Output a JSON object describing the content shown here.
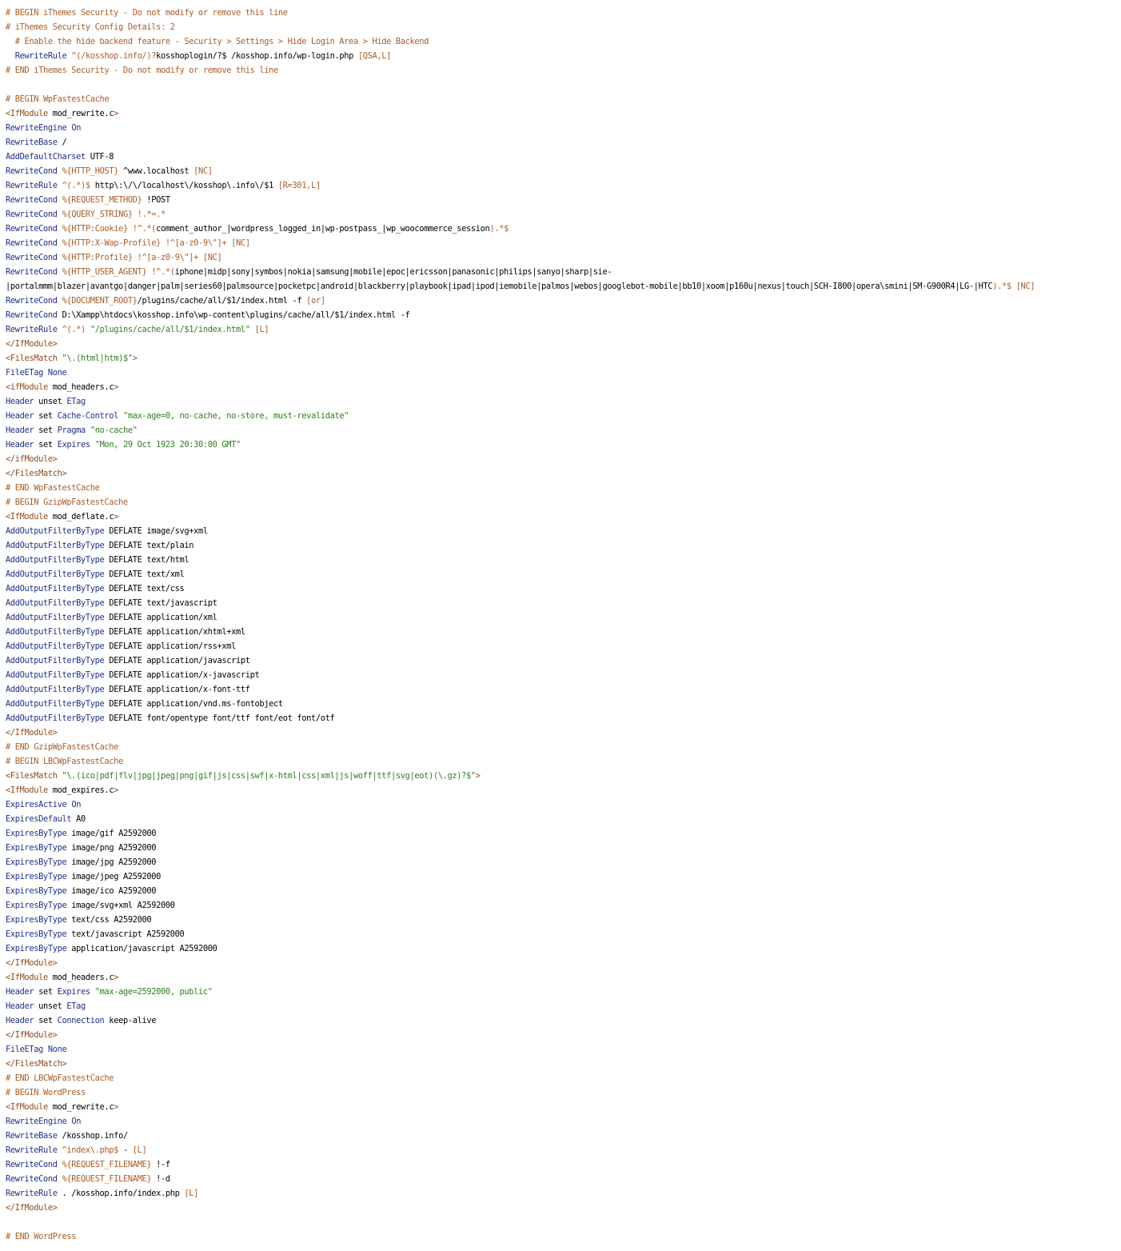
{
  "colors": {
    "comment": "#a85c28",
    "directive": "#1f2f8a",
    "tag": "#8f4a1a",
    "string": "#2e7d1f",
    "variable": "#a85c28",
    "plain": "#000000",
    "background": "#ffffff"
  },
  "lines": [
    [
      [
        "cm",
        "# BEGIN iThemes Security - Do not modify or remove this line"
      ]
    ],
    [
      [
        "cm",
        "# iThemes Security Config Details: 2"
      ]
    ],
    [
      [
        "cm",
        "  # Enable the hide backend feature - Security > Settings > Hide Login Area > Hide Backend"
      ]
    ],
    [
      [
        "pl",
        "  "
      ],
      [
        "kw",
        "RewriteRule"
      ],
      [
        "pl",
        " "
      ],
      [
        "vr",
        "^(/kosshop.info/)?"
      ],
      [
        "pl",
        "kosshoplogin/?$ /kosshop.info/wp-login.php "
      ],
      [
        "vr",
        "[QSA,L]"
      ]
    ],
    [
      [
        "cm",
        "# END iThemes Security - Do not modify or remove this line"
      ]
    ],
    [
      [
        "pl",
        ""
      ]
    ],
    [
      [
        "cm",
        "# BEGIN WpFastestCache"
      ]
    ],
    [
      [
        "tg",
        "<IfModule"
      ],
      [
        "pl",
        " mod_rewrite.c"
      ],
      [
        "tg",
        ">"
      ]
    ],
    [
      [
        "kw",
        "RewriteEngine"
      ],
      [
        "pl",
        " "
      ],
      [
        "kw",
        "On"
      ]
    ],
    [
      [
        "kw",
        "RewriteBase"
      ],
      [
        "pl",
        " /"
      ]
    ],
    [
      [
        "kw",
        "AddDefaultCharset"
      ],
      [
        "pl",
        " UTF-8"
      ]
    ],
    [
      [
        "kw",
        "RewriteCond"
      ],
      [
        "pl",
        " "
      ],
      [
        "vr",
        "%{HTTP_HOST}"
      ],
      [
        "pl",
        " ^www.localhost "
      ],
      [
        "vr",
        "[NC]"
      ]
    ],
    [
      [
        "kw",
        "RewriteRule"
      ],
      [
        "pl",
        " "
      ],
      [
        "vr",
        "^(.*)$"
      ],
      [
        "pl",
        " http\\:\\/\\/localhost\\/kosshop\\.info\\/$1 "
      ],
      [
        "vr",
        "[R=301,L]"
      ]
    ],
    [
      [
        "kw",
        "RewriteCond"
      ],
      [
        "pl",
        " "
      ],
      [
        "vr",
        "%{REQUEST_METHOD}"
      ],
      [
        "pl",
        " !POST"
      ]
    ],
    [
      [
        "kw",
        "RewriteCond"
      ],
      [
        "pl",
        " "
      ],
      [
        "vr",
        "%{QUERY_STRING}"
      ],
      [
        "pl",
        " "
      ],
      [
        "vr",
        "!.*=.*"
      ]
    ],
    [
      [
        "kw",
        "RewriteCond"
      ],
      [
        "pl",
        " "
      ],
      [
        "vr",
        "%{HTTP:Cookie}"
      ],
      [
        "pl",
        " "
      ],
      [
        "vr",
        "!^.*("
      ],
      [
        "pl",
        "comment_author_|wordpress_logged_in|wp-postpass_|wp_woocommerce_session"
      ],
      [
        "vr",
        ").*$"
      ]
    ],
    [
      [
        "kw",
        "RewriteCond"
      ],
      [
        "pl",
        " "
      ],
      [
        "vr",
        "%{HTTP:X-Wap-Profile}"
      ],
      [
        "pl",
        " "
      ],
      [
        "vr",
        "!^[a-z0-9\\\"]+"
      ],
      [
        "pl",
        " "
      ],
      [
        "vr",
        "[NC]"
      ]
    ],
    [
      [
        "kw",
        "RewriteCond"
      ],
      [
        "pl",
        " "
      ],
      [
        "vr",
        "%{HTTP:Profile}"
      ],
      [
        "pl",
        " "
      ],
      [
        "vr",
        "!^[a-z0-9\\\"]+"
      ],
      [
        "pl",
        " "
      ],
      [
        "vr",
        "[NC]"
      ]
    ],
    [
      [
        "kw",
        "RewriteCond"
      ],
      [
        "pl",
        " "
      ],
      [
        "vr",
        "%{HTTP_USER_AGENT}"
      ],
      [
        "pl",
        " "
      ],
      [
        "vr",
        "!^.*("
      ],
      [
        "pl",
        "iphone|midp|sony|symbos|nokia|samsung|mobile|epoc|ericsson|panasonic|philips|sanyo|sharp|sie-"
      ]
    ],
    [
      [
        "pl",
        "|portalmmm|blazer|avantgo|danger|palm|series60|palmsource|pocketpc|android|blackberry|playbook|ipad|ipod|iemobile|palmos|webos|googlebot-mobile|bb10|xoom|p160u|nexus|touch|SCH-I800|opera\\smini|SM-G900R4|LG-|HTC"
      ],
      [
        "vr",
        ").*$"
      ],
      [
        "pl",
        " "
      ],
      [
        "vr",
        "[NC]"
      ]
    ],
    [
      [
        "kw",
        "RewriteCond"
      ],
      [
        "pl",
        " "
      ],
      [
        "vr",
        "%{DOCUMENT_ROOT}"
      ],
      [
        "pl",
        "/plugins/cache/all/$1/index.html -f "
      ],
      [
        "vr",
        "[or]"
      ]
    ],
    [
      [
        "kw",
        "RewriteCond"
      ],
      [
        "pl",
        " D:\\Xampp\\htdocs\\kosshop.info\\wp-content\\plugins/cache/all/$1/index.html -f"
      ]
    ],
    [
      [
        "kw",
        "RewriteRule"
      ],
      [
        "pl",
        " "
      ],
      [
        "vr",
        "^(.*)"
      ],
      [
        "pl",
        " "
      ],
      [
        "st",
        "\"/plugins/cache/all/$1/index.html\""
      ],
      [
        "pl",
        " "
      ],
      [
        "vr",
        "[L]"
      ]
    ],
    [
      [
        "tg",
        "</IfModule>"
      ]
    ],
    [
      [
        "tg",
        "<FilesMatch"
      ],
      [
        "pl",
        " "
      ],
      [
        "st",
        "\"\\.(html|htm)$\""
      ],
      [
        "tg",
        ">"
      ]
    ],
    [
      [
        "kw",
        "FileETag"
      ],
      [
        "pl",
        " "
      ],
      [
        "kw",
        "None"
      ]
    ],
    [
      [
        "tg",
        "<ifModule"
      ],
      [
        "pl",
        " mod_headers.c"
      ],
      [
        "tg",
        ">"
      ]
    ],
    [
      [
        "kw",
        "Header"
      ],
      [
        "pl",
        " unset "
      ],
      [
        "kw",
        "ETag"
      ]
    ],
    [
      [
        "kw",
        "Header"
      ],
      [
        "pl",
        " set "
      ],
      [
        "kw",
        "Cache-Control"
      ],
      [
        "pl",
        " "
      ],
      [
        "st",
        "\"max-age=0, no-cache, no-store, must-revalidate\""
      ]
    ],
    [
      [
        "kw",
        "Header"
      ],
      [
        "pl",
        " set "
      ],
      [
        "kw",
        "Pragma"
      ],
      [
        "pl",
        " "
      ],
      [
        "st",
        "\"no-cache\""
      ]
    ],
    [
      [
        "kw",
        "Header"
      ],
      [
        "pl",
        " set "
      ],
      [
        "kw",
        "Expires"
      ],
      [
        "pl",
        " "
      ],
      [
        "st",
        "\"Mon, 29 Oct 1923 20:30:00 GMT\""
      ]
    ],
    [
      [
        "tg",
        "</ifModule>"
      ]
    ],
    [
      [
        "tg",
        "</FilesMatch>"
      ]
    ],
    [
      [
        "cm",
        "# END WpFastestCache"
      ]
    ],
    [
      [
        "cm",
        "# BEGIN GzipWpFastestCache"
      ]
    ],
    [
      [
        "tg",
        "<IfModule"
      ],
      [
        "pl",
        " mod_deflate.c"
      ],
      [
        "tg",
        ">"
      ]
    ],
    [
      [
        "kw",
        "AddOutputFilterByType"
      ],
      [
        "pl",
        " DEFLATE image/svg+xml"
      ]
    ],
    [
      [
        "kw",
        "AddOutputFilterByType"
      ],
      [
        "pl",
        " DEFLATE text/plain"
      ]
    ],
    [
      [
        "kw",
        "AddOutputFilterByType"
      ],
      [
        "pl",
        " DEFLATE text/html"
      ]
    ],
    [
      [
        "kw",
        "AddOutputFilterByType"
      ],
      [
        "pl",
        " DEFLATE text/xml"
      ]
    ],
    [
      [
        "kw",
        "AddOutputFilterByType"
      ],
      [
        "pl",
        " DEFLATE text/css"
      ]
    ],
    [
      [
        "kw",
        "AddOutputFilterByType"
      ],
      [
        "pl",
        " DEFLATE text/javascript"
      ]
    ],
    [
      [
        "kw",
        "AddOutputFilterByType"
      ],
      [
        "pl",
        " DEFLATE application/xml"
      ]
    ],
    [
      [
        "kw",
        "AddOutputFilterByType"
      ],
      [
        "pl",
        " DEFLATE application/xhtml+xml"
      ]
    ],
    [
      [
        "kw",
        "AddOutputFilterByType"
      ],
      [
        "pl",
        " DEFLATE application/rss+xml"
      ]
    ],
    [
      [
        "kw",
        "AddOutputFilterByType"
      ],
      [
        "pl",
        " DEFLATE application/javascript"
      ]
    ],
    [
      [
        "kw",
        "AddOutputFilterByType"
      ],
      [
        "pl",
        " DEFLATE application/x-javascript"
      ]
    ],
    [
      [
        "kw",
        "AddOutputFilterByType"
      ],
      [
        "pl",
        " DEFLATE application/x-font-ttf"
      ]
    ],
    [
      [
        "kw",
        "AddOutputFilterByType"
      ],
      [
        "pl",
        " DEFLATE application/vnd.ms-fontobject"
      ]
    ],
    [
      [
        "kw",
        "AddOutputFilterByType"
      ],
      [
        "pl",
        " DEFLATE font/opentype font/ttf font/eot font/otf"
      ]
    ],
    [
      [
        "tg",
        "</IfModule>"
      ]
    ],
    [
      [
        "cm",
        "# END GzipWpFastestCache"
      ]
    ],
    [
      [
        "cm",
        "# BEGIN LBCWpFastestCache"
      ]
    ],
    [
      [
        "tg",
        "<FilesMatch"
      ],
      [
        "pl",
        " "
      ],
      [
        "st",
        "\"\\.(ico|pdf|flv|jpg|jpeg|png|gif|js|css|swf|x-html|css|xml|js|woff|ttf|svg|eot)(\\.gz)?$\""
      ],
      [
        "tg",
        ">"
      ]
    ],
    [
      [
        "tg",
        "<IfModule"
      ],
      [
        "pl",
        " mod_expires.c"
      ],
      [
        "tg",
        ">"
      ]
    ],
    [
      [
        "kw",
        "ExpiresActive"
      ],
      [
        "pl",
        " "
      ],
      [
        "kw",
        "On"
      ]
    ],
    [
      [
        "kw",
        "ExpiresDefault"
      ],
      [
        "pl",
        " A0"
      ]
    ],
    [
      [
        "kw",
        "ExpiresByType"
      ],
      [
        "pl",
        " image/gif A2592000"
      ]
    ],
    [
      [
        "kw",
        "ExpiresByType"
      ],
      [
        "pl",
        " image/png A2592000"
      ]
    ],
    [
      [
        "kw",
        "ExpiresByType"
      ],
      [
        "pl",
        " image/jpg A2592000"
      ]
    ],
    [
      [
        "kw",
        "ExpiresByType"
      ],
      [
        "pl",
        " image/jpeg A2592000"
      ]
    ],
    [
      [
        "kw",
        "ExpiresByType"
      ],
      [
        "pl",
        " image/ico A2592000"
      ]
    ],
    [
      [
        "kw",
        "ExpiresByType"
      ],
      [
        "pl",
        " image/svg+xml A2592000"
      ]
    ],
    [
      [
        "kw",
        "ExpiresByType"
      ],
      [
        "pl",
        " text/css A2592000"
      ]
    ],
    [
      [
        "kw",
        "ExpiresByType"
      ],
      [
        "pl",
        " text/javascript A2592000"
      ]
    ],
    [
      [
        "kw",
        "ExpiresByType"
      ],
      [
        "pl",
        " application/javascript A2592000"
      ]
    ],
    [
      [
        "tg",
        "</IfModule>"
      ]
    ],
    [
      [
        "tg",
        "<IfModule"
      ],
      [
        "pl",
        " mod_headers.c"
      ],
      [
        "tg",
        ">"
      ]
    ],
    [
      [
        "kw",
        "Header"
      ],
      [
        "pl",
        " set "
      ],
      [
        "kw",
        "Expires"
      ],
      [
        "pl",
        " "
      ],
      [
        "st",
        "\"max-age=2592000, public\""
      ]
    ],
    [
      [
        "kw",
        "Header"
      ],
      [
        "pl",
        " unset "
      ],
      [
        "kw",
        "ETag"
      ]
    ],
    [
      [
        "kw",
        "Header"
      ],
      [
        "pl",
        " set "
      ],
      [
        "kw",
        "Connection"
      ],
      [
        "pl",
        " keep-alive"
      ]
    ],
    [
      [
        "tg",
        "</IfModule>"
      ]
    ],
    [
      [
        "kw",
        "FileETag"
      ],
      [
        "pl",
        " "
      ],
      [
        "kw",
        "None"
      ]
    ],
    [
      [
        "tg",
        "</FilesMatch>"
      ]
    ],
    [
      [
        "cm",
        "# END LBCWpFastestCache"
      ]
    ],
    [
      [
        "cm",
        "# BEGIN WordPress"
      ]
    ],
    [
      [
        "tg",
        "<IfModule"
      ],
      [
        "pl",
        " mod_rewrite.c"
      ],
      [
        "tg",
        ">"
      ]
    ],
    [
      [
        "kw",
        "RewriteEngine"
      ],
      [
        "pl",
        " "
      ],
      [
        "kw",
        "On"
      ]
    ],
    [
      [
        "kw",
        "RewriteBase"
      ],
      [
        "pl",
        " /kosshop.info/"
      ]
    ],
    [
      [
        "kw",
        "RewriteRule"
      ],
      [
        "pl",
        " "
      ],
      [
        "vr",
        "^index\\.php$"
      ],
      [
        "pl",
        " - "
      ],
      [
        "vr",
        "[L]"
      ]
    ],
    [
      [
        "kw",
        "RewriteCond"
      ],
      [
        "pl",
        " "
      ],
      [
        "vr",
        "%{REQUEST_FILENAME}"
      ],
      [
        "pl",
        " !-f"
      ]
    ],
    [
      [
        "kw",
        "RewriteCond"
      ],
      [
        "pl",
        " "
      ],
      [
        "vr",
        "%{REQUEST_FILENAME}"
      ],
      [
        "pl",
        " !-d"
      ]
    ],
    [
      [
        "kw",
        "RewriteRule"
      ],
      [
        "pl",
        " . /kosshop.info/index.php "
      ],
      [
        "vr",
        "[L]"
      ]
    ],
    [
      [
        "tg",
        "</IfModule>"
      ]
    ],
    [
      [
        "pl",
        ""
      ]
    ],
    [
      [
        "cm",
        "# END WordPress"
      ]
    ]
  ]
}
